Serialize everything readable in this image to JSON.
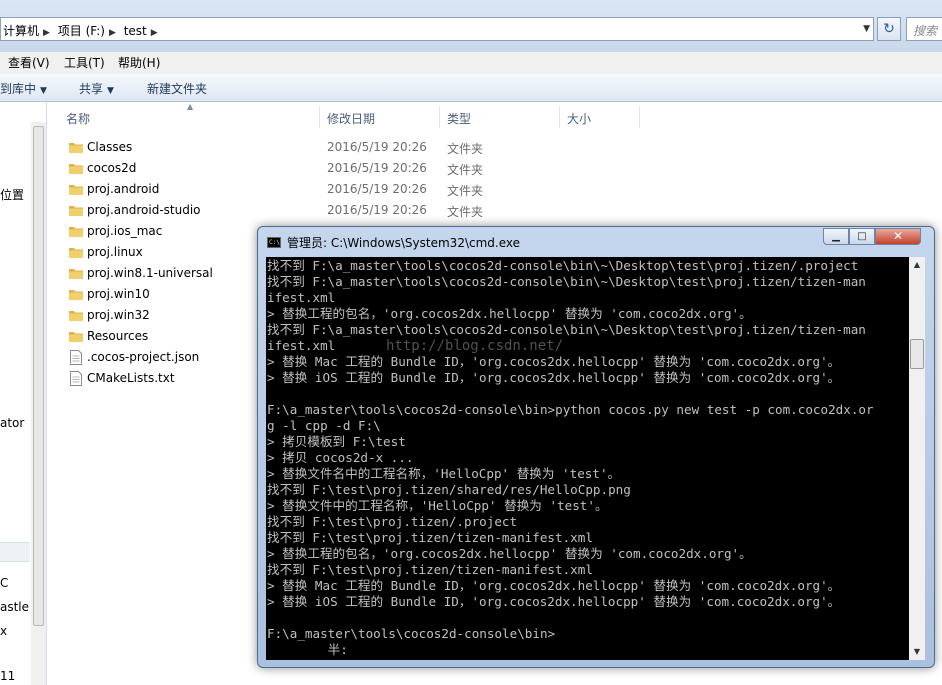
{
  "address_bar": {
    "crumbs": [
      "计算机",
      "项目 (F:)",
      "test"
    ],
    "search_placeholder": "搜索"
  },
  "menu": [
    "查看(V)",
    "工具(T)",
    "帮助(H)"
  ],
  "toolbar": {
    "include_library": "到库中",
    "share": "共享",
    "new_folder": "新建文件夹"
  },
  "nav_labels": [
    "位置",
    "ator",
    "C",
    "astle",
    "x",
    "11"
  ],
  "columns": {
    "name": "名称",
    "modified": "修改日期",
    "type": "类型",
    "size": "大小"
  },
  "files": [
    {
      "name": "Classes",
      "date": "2016/5/19 20:26",
      "type": "文件夹",
      "icon": "folder-icon"
    },
    {
      "name": "cocos2d",
      "date": "2016/5/19 20:26",
      "type": "文件夹",
      "icon": "folder-icon"
    },
    {
      "name": "proj.android",
      "date": "2016/5/19 20:26",
      "type": "文件夹",
      "icon": "folder-icon"
    },
    {
      "name": "proj.android-studio",
      "date": "2016/5/19 20:26",
      "type": "文件夹",
      "icon": "folder-icon"
    },
    {
      "name": "proj.ios_mac",
      "date": "",
      "type": "",
      "icon": "folder-icon"
    },
    {
      "name": "proj.linux",
      "date": "",
      "type": "",
      "icon": "folder-icon"
    },
    {
      "name": "proj.win8.1-universal",
      "date": "",
      "type": "",
      "icon": "folder-icon"
    },
    {
      "name": "proj.win10",
      "date": "",
      "type": "",
      "icon": "folder-icon"
    },
    {
      "name": "proj.win32",
      "date": "",
      "type": "",
      "icon": "folder-icon"
    },
    {
      "name": "Resources",
      "date": "",
      "type": "",
      "icon": "folder-icon"
    },
    {
      "name": ".cocos-project.json",
      "date": "",
      "type": "",
      "icon": "file-icon"
    },
    {
      "name": "CMakeLists.txt",
      "date": "",
      "type": "",
      "icon": "file-icon"
    }
  ],
  "cmd": {
    "title": "管理员: C:\\Windows\\System32\\cmd.exe",
    "icon_text": "C:\\",
    "watermark": "http://blog.csdn.net/",
    "lines": [
      "找不到 F:\\a_master\\tools\\cocos2d-console\\bin\\~\\Desktop\\test\\proj.tizen/.project",
      "找不到 F:\\a_master\\tools\\cocos2d-console\\bin\\~\\Desktop\\test\\proj.tizen/tizen-man",
      "ifest.xml",
      "> 替换工程的包名，'org.cocos2dx.hellocpp' 替换为 'com.coco2dx.org'。",
      "找不到 F:\\a_master\\tools\\cocos2d-console\\bin\\~\\Desktop\\test\\proj.tizen/tizen-man",
      "ifest.xml",
      "> 替换 Mac 工程的 Bundle ID，'org.cocos2dx.hellocpp' 替换为 'com.coco2dx.org'。",
      "> 替换 iOS 工程的 Bundle ID，'org.cocos2dx.hellocpp' 替换为 'com.coco2dx.org'。",
      "",
      "F:\\a_master\\tools\\cocos2d-console\\bin>python cocos.py new test -p com.coco2dx.or",
      "g -l cpp -d F:\\",
      "> 拷贝模板到 F:\\test",
      "> 拷贝 cocos2d-x ...",
      "> 替换文件名中的工程名称，'HelloCpp' 替换为 'test'。",
      "找不到 F:\\test\\proj.tizen/shared/res/HelloCpp.png",
      "> 替换文件中的工程名称，'HelloCpp' 替换为 'test'。",
      "找不到 F:\\test\\proj.tizen/.project",
      "找不到 F:\\test\\proj.tizen/tizen-manifest.xml",
      "> 替换工程的包名，'org.cocos2dx.hellocpp' 替换为 'com.coco2dx.org'。",
      "找不到 F:\\test\\proj.tizen/tizen-manifest.xml",
      "> 替换 Mac 工程的 Bundle ID，'org.cocos2dx.hellocpp' 替换为 'com.coco2dx.org'。",
      "> 替换 iOS 工程的 Bundle ID，'org.cocos2dx.hellocpp' 替换为 'com.coco2dx.org'。",
      "",
      "F:\\a_master\\tools\\cocos2d-console\\bin>",
      "        半:"
    ]
  }
}
